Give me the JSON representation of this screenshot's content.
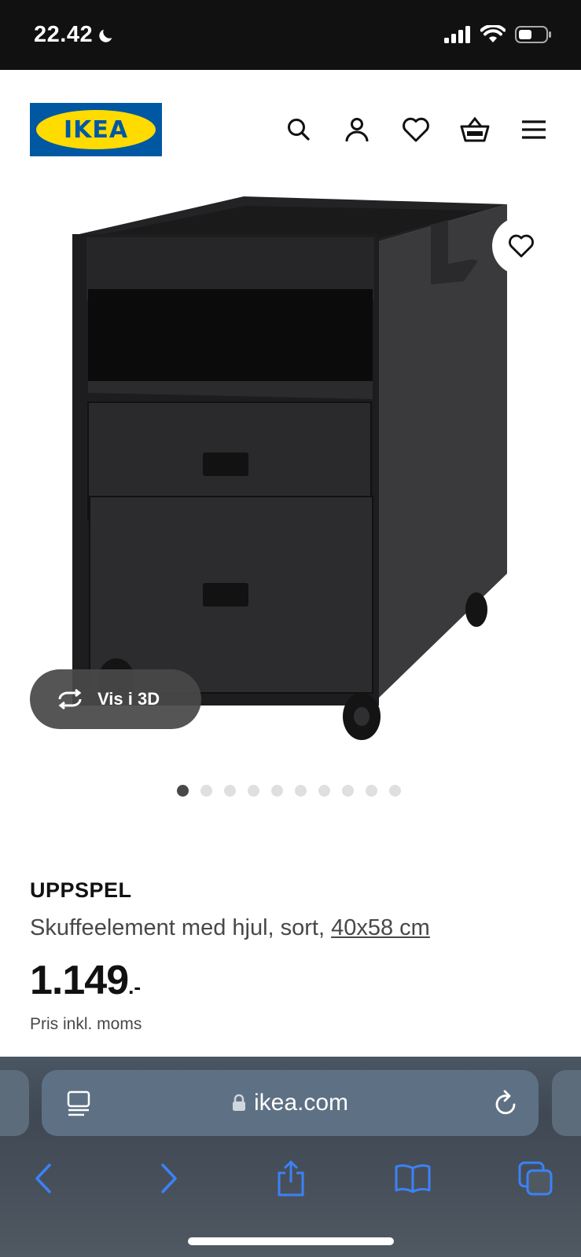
{
  "status_bar": {
    "time": "22.42"
  },
  "header": {
    "logo_text": "IKEA",
    "icons": [
      "search-icon",
      "account-icon",
      "favourites-icon",
      "basket-icon",
      "menu-icon"
    ]
  },
  "gallery": {
    "view3d_label": "Vis i 3D",
    "dot_count": 10,
    "active_dot": 1
  },
  "product": {
    "name": "UPPSPEL",
    "description": "Skuffeelement med hjul, sort, ",
    "size_link": "40x58 cm",
    "price": "1.149",
    "price_suffix": ".-",
    "price_note": "Pris inkl. moms"
  },
  "browser": {
    "url": "ikea.com",
    "toolbar": [
      "back-icon",
      "forward-icon",
      "share-icon",
      "bookmarks-icon",
      "tabs-icon"
    ]
  },
  "colors": {
    "brand_blue": "#0058a3",
    "brand_yellow": "#ffdb00",
    "safari_accent": "#3b82f6"
  }
}
